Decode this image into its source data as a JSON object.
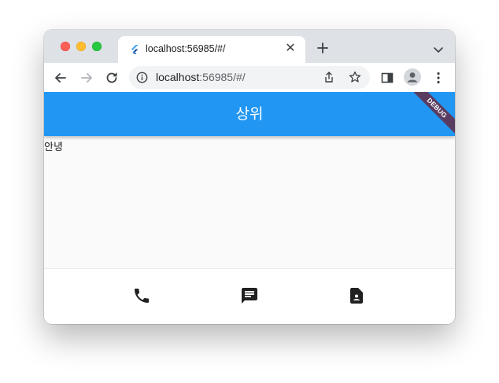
{
  "browser": {
    "tab": {
      "title": "localhost:56985/#/",
      "favicon": "flutter-icon",
      "close_glyph": "✕"
    },
    "address_bar": {
      "url_host": "localhost",
      "url_rest": ":56985/#/"
    },
    "icons": {
      "back": "arrow-left-icon",
      "forward": "arrow-right-icon",
      "reload": "reload-icon",
      "site_info": "info-icon",
      "share": "share-icon",
      "bookmark": "star-icon",
      "side_panel": "side-panel-icon",
      "profile": "profile-avatar-icon",
      "menu": "more-vert-icon",
      "new_tab": "plus-icon",
      "tab_search": "chevron-down-icon"
    }
  },
  "app": {
    "appbar_title": "상위",
    "debug_banner": "DEBUG",
    "body_text": "안녕",
    "bottom_nav": [
      {
        "icon": "phone-icon"
      },
      {
        "icon": "chat-icon"
      },
      {
        "icon": "contact-document-icon"
      }
    ],
    "colors": {
      "primary": "#2196f3",
      "background": "#fafafa",
      "nav_icon": "#212121"
    }
  }
}
